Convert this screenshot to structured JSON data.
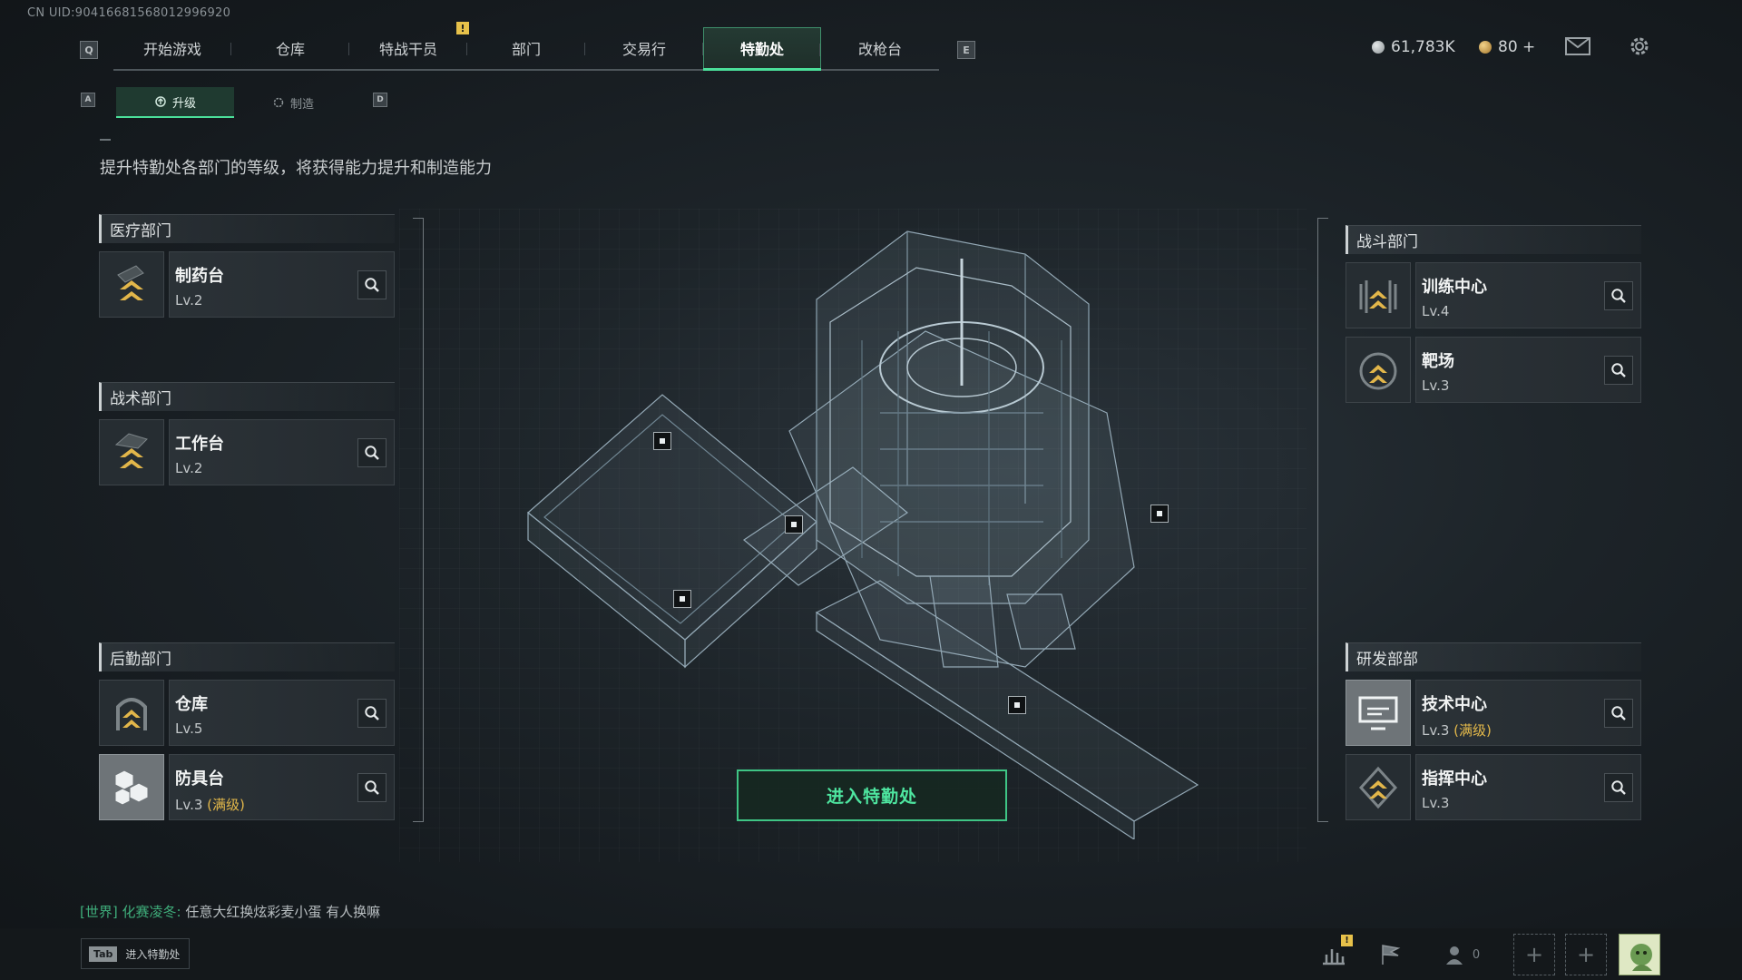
{
  "uid": "CN UID:9041668156801​2996920",
  "nav": {
    "left_key": "Q",
    "right_key": "E",
    "tabs": [
      {
        "label": "开始游戏"
      },
      {
        "label": "仓库"
      },
      {
        "label": "特战干员",
        "alert": "!"
      },
      {
        "label": "部门"
      },
      {
        "label": "交易行"
      },
      {
        "label": "特勤处",
        "active": true
      },
      {
        "label": "改枪台"
      }
    ]
  },
  "currency": {
    "silver": "61,783K",
    "gold": "80 +"
  },
  "subtabs": {
    "left_key": "A",
    "right_key": "D",
    "upgrade": "升级",
    "craft": "制造"
  },
  "subtitle": "提升特勤处各部门的等级，将获得能力提升和制造能力",
  "departments": {
    "medical": {
      "name": "医疗部门",
      "facilities": [
        {
          "name": "制药台",
          "level": "Lv.2",
          "max": ""
        }
      ]
    },
    "tactical": {
      "name": "战术部门",
      "facilities": [
        {
          "name": "工作台",
          "level": "Lv.2",
          "max": ""
        }
      ]
    },
    "logistics": {
      "name": "后勤部门",
      "facilities": [
        {
          "name": "仓库",
          "level": "Lv.5",
          "max": ""
        },
        {
          "name": "防具台",
          "level": "Lv.3",
          "max": "(满级)"
        }
      ]
    },
    "combat": {
      "name": "战斗部门",
      "facilities": [
        {
          "name": "训练中心",
          "level": "Lv.4",
          "max": ""
        },
        {
          "name": "靶场",
          "level": "Lv.3",
          "max": ""
        }
      ]
    },
    "rnd": {
      "name": "研发部部",
      "facilities": [
        {
          "name": "技术中心",
          "level": "Lv.3",
          "max": "(满级)"
        },
        {
          "name": "指挥中心",
          "level": "Lv.3",
          "max": ""
        }
      ]
    }
  },
  "enter_button": "进入特勤处",
  "chat": {
    "channel": "[世界]",
    "sender": "化赛凌冬:",
    "message": "任意大红换炫彩麦小蛋 有人换嘛"
  },
  "tab_hint": {
    "key": "Tab",
    "label": "进入特勤处"
  },
  "bottom": {
    "stats_alert": "!",
    "friends_count": "0"
  },
  "colors": {
    "accent": "#4be09a",
    "max_level": "#e3b84a",
    "alert": "#e7c14a"
  }
}
